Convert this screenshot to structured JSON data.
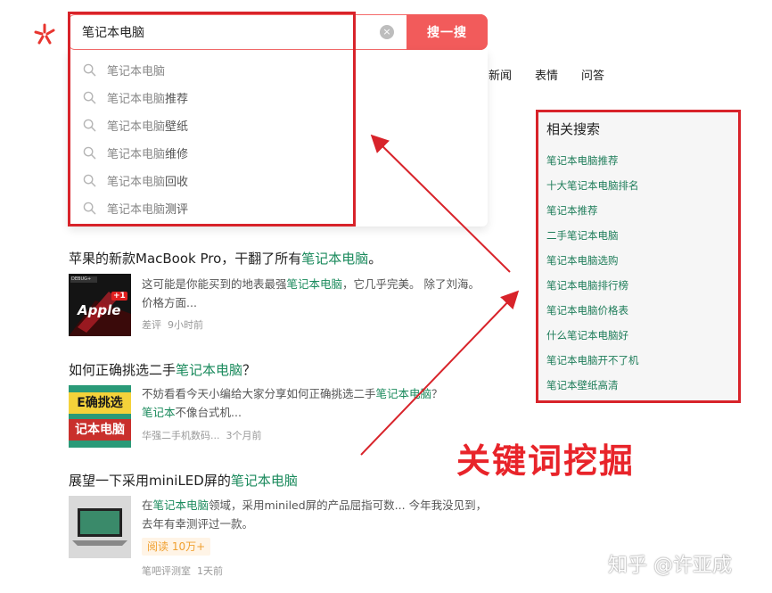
{
  "search": {
    "query": "笔记本电脑",
    "button_label": "搜一搜",
    "clear_glyph": "×"
  },
  "suggestions": [
    {
      "prefix": "笔记本电脑",
      "suffix": ""
    },
    {
      "prefix": "笔记本电脑",
      "suffix": "推荐"
    },
    {
      "prefix": "笔记本电脑",
      "suffix": "壁纸"
    },
    {
      "prefix": "笔记本电脑",
      "suffix": "维修"
    },
    {
      "prefix": "笔记本电脑",
      "suffix": "回收"
    },
    {
      "prefix": "笔记本电脑",
      "suffix": "测评"
    }
  ],
  "nav": [
    "新闻",
    "表情",
    "问答"
  ],
  "related": {
    "title": "相关搜索",
    "items": [
      "笔记本电脑推荐",
      "十大笔记本电脑排名",
      "笔记本推荐",
      "二手笔记本电脑",
      "笔记本电脑选购",
      "笔记本电脑排行榜",
      "笔记本电脑价格表",
      "什么笔记本电脑好",
      "笔记本电脑开不了机",
      "笔记本壁纸高清"
    ]
  },
  "results": [
    {
      "title_a": "苹果的新款MacBook Pro，干翻了所有",
      "title_hl": "笔记本电脑",
      "title_b": "。",
      "desc_a": "这可能是你能买到的地表最强",
      "desc_hl": "笔记本电脑",
      "desc_b": "，它几乎完美。 除了刘海。 价格方面...",
      "source": "差评",
      "time": "9小时前",
      "thumb_text": "Apple",
      "thumb_badge": "+1",
      "thumb_tag": "DEBUG+"
    },
    {
      "title_a": "如何正确挑选二手",
      "title_hl": "笔记本电脑",
      "title_b": "？",
      "desc_a": "不妨看看今天小编给大家分享如何正确挑选二手",
      "desc_hl": "笔记本电脑",
      "desc_b": "？",
      "desc2_hl": "笔记本",
      "desc2_b": "不像台式机...",
      "source": "华强二手机数码...",
      "time": "3个月前",
      "thumb_line1": "E确挑选",
      "thumb_line2": "记本电脑"
    },
    {
      "title_a": "展望一下采用miniLED屏的",
      "title_hl": "笔记本电脑",
      "title_b": "",
      "desc_a": "在",
      "desc_hl": "笔记本电脑",
      "desc_b": "领域，采用miniled屏的产品屈指可数... 今年我没见到，去年有幸测评过一款。",
      "read_label": "阅读 10万+",
      "source": "笔吧评测室",
      "time": "1天前"
    }
  ],
  "annotation": "关键词挖掘",
  "watermark": "知乎 @许亚成",
  "colors": {
    "accent": "#f25b5b",
    "highlight_word": "#1a8a5c",
    "annotation_red": "#d8232a"
  }
}
